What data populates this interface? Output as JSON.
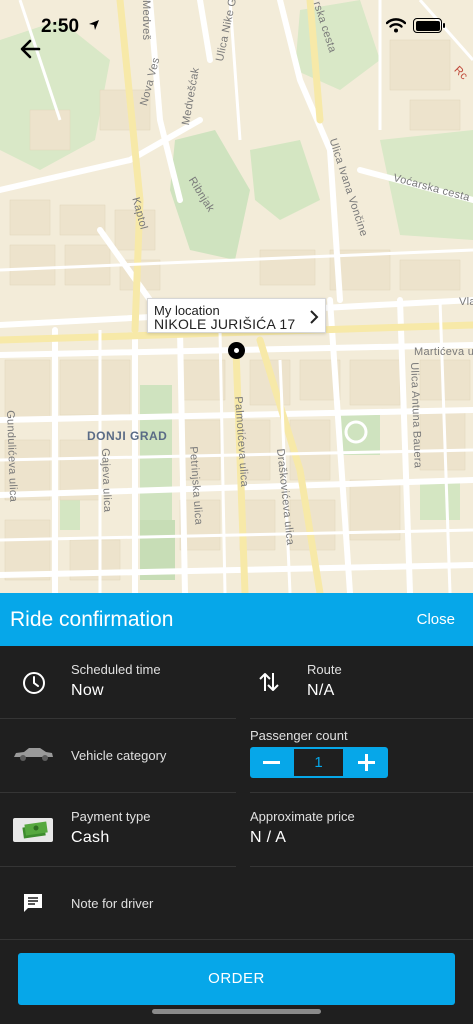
{
  "status_bar": {
    "time": "2:50"
  },
  "map": {
    "streets": {
      "nova_ves": "Nova Ves",
      "medvescak": "Medvešćak",
      "ulica_nike": "Ulica Nike G",
      "medvescak_top": "Medveš",
      "kaptol": "Kaptol",
      "ribnjak": "Ribnjak",
      "ulica_ivana_vancine": "Ulica Ivana Vončine",
      "vocarska_cesta": "Voćarska cesta",
      "rska_cesta": "rska cesta",
      "vla": "Vla",
      "marticeva": "Martićeva ulic",
      "ulica_antuna_bauera": "Ulica Antuna Bauera",
      "gunduliceva": "Gundulićeva ulica",
      "gajeva": "Gajeva ulica",
      "petrinjska": "Petrinjska ulica",
      "palmoticeva": "Palmotićeva ulica",
      "draskoviceva": "Draškovićeva ulica"
    },
    "district": "DONJI GRAD",
    "callout": {
      "title": "My location",
      "address": "NIKOLE JURIŠIĆA 17"
    }
  },
  "panel": {
    "title": "Ride confirmation",
    "close_label": "Close",
    "scheduled_time_label": "Scheduled time",
    "scheduled_time_value": "Now",
    "route_label": "Route",
    "route_value": "N/A",
    "vehicle_category_label": "Vehicle category",
    "passenger_count_label": "Passenger count",
    "passenger_count_value": "1",
    "payment_type_label": "Payment type",
    "payment_type_value": "Cash",
    "approx_price_label": "Approximate price",
    "approx_price_value": "N / A",
    "note_label": "Note for driver",
    "order_label": "ORDER"
  },
  "colors": {
    "accent": "#06a7e9",
    "panel_bg": "#1f1f1f",
    "map_bg": "#f3ecd9",
    "park": "#cfe3bf",
    "road": "#ffffff",
    "major_road": "#f7e9a8"
  },
  "icons": [
    "back-arrow-icon",
    "location-arrow-icon",
    "wifi-icon",
    "battery-icon",
    "chevron-right-icon",
    "clock-icon",
    "route-swap-icon",
    "car-icon",
    "cash-icon",
    "message-icon"
  ]
}
